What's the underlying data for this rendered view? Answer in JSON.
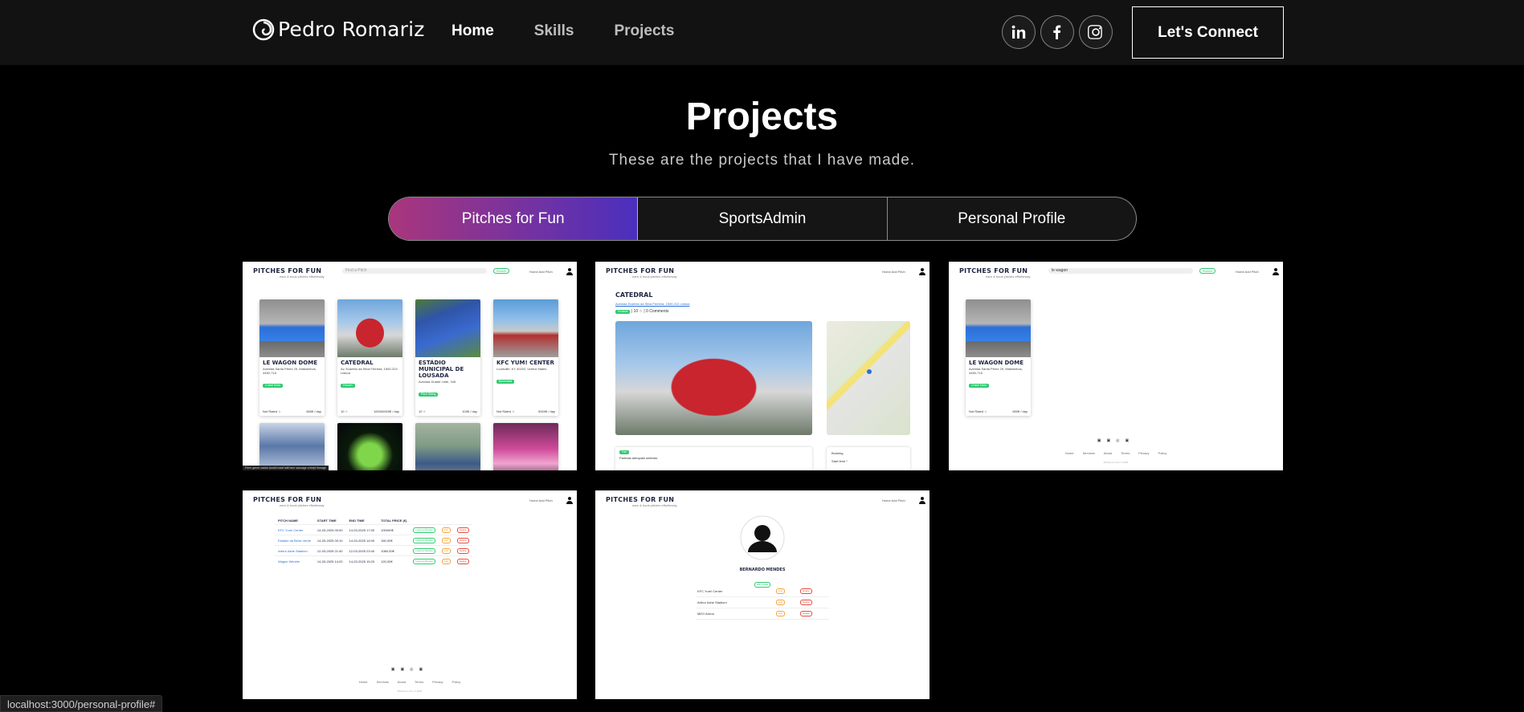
{
  "navbar": {
    "brand": "Pedro Romariz",
    "links": [
      {
        "label": "Home"
      },
      {
        "label": "Skills"
      },
      {
        "label": "Projects"
      }
    ],
    "socials": [
      "linkedin-icon",
      "facebook-icon",
      "instagram-icon"
    ],
    "connect_label": "Let's Connect"
  },
  "header": {
    "title": "Projects",
    "subtitle": "These are the projects that I have made."
  },
  "tabs": [
    {
      "label": "Pitches for Fun",
      "active": true
    },
    {
      "label": "SportsAdmin",
      "active": false
    },
    {
      "label": "Personal Profile",
      "active": false
    }
  ],
  "colors": {
    "tab_gradient_start": "#aa367c",
    "tab_gradient_end": "#4a2fbd",
    "navbar_bg": "#121212",
    "page_bg": "#000000",
    "site_green": "#2ecc71"
  },
  "mini_site": {
    "logo": "PITCHES FOR FUN",
    "tagline": "earn & book pitches effortlessly",
    "search_placeholder": "Find a Pitch",
    "search_btn": "Search",
    "nav": "Home  Add Pitch",
    "footer_links": "Home Services About Terms Privacy Policy",
    "footer_copy": "Pitches for Fun © 2025"
  },
  "project_1": {
    "pitches": [
      {
        "name": "LE WAGON DOME",
        "address": "Avenida Santa Pérez 29, Matosinhos, 4450-715",
        "badge": "Cristel Kerto",
        "rating": "Not Rated ☆",
        "price": "650€ / day"
      },
      {
        "name": "CATEDRAL",
        "address": "Av. Eusébio da Silva Ferreira, 1500-313 Lisboa",
        "badge": "Flamen",
        "rating": "10 ☆",
        "price": "100000000€ / day"
      },
      {
        "name": "ESTÁDIO MUNICIPAL DE LOUSADA",
        "address": "Avenida Duarte Leite, 345",
        "badge": "Pitch Sitting",
        "rating": "10 ☆",
        "price": "100€ / day"
      },
      {
        "name": "KFC YUM! CENTER",
        "address": "Louisville, KY 40202, United States",
        "badge": "Basketball",
        "rating": "Not Rated ☆",
        "price": "5000€ / day"
      }
    ],
    "overlay_caption": "Ferro genre cantor Aoubli meal tailt beur sausage a teept Itsnage"
  },
  "project_2": {
    "title": "CATEDRAL",
    "address": "Avenida Eusébio da Silva Ferreira, 1500-313 Lisboa",
    "badge": "Football",
    "meta": "| 10 ☆ | 0 Comments",
    "review_badge": "Fair",
    "review_text": "Partidas adequais sintéam.",
    "booking_label": "Booking",
    "start_label": "Start time *"
  },
  "project_3": {
    "search_value": "le wagon",
    "pitch": {
      "name": "LE WAGON DOME",
      "address": "Avenida Santa Pérez 29, Matosinhos, 4450-715",
      "badge": "Cristel Kerto",
      "rating": "Not Rated ☆",
      "price": "650€ / day"
    }
  },
  "project_4": {
    "columns": [
      "PITCH NAME",
      "START TIME",
      "END TIME",
      "TOTAL PRICE (€)"
    ],
    "rows": [
      [
        "KFC Yum! Center",
        "14-03-2025 00:00",
        "14-03-2025 17:00",
        "100000€"
      ],
      [
        "Estádio da Beira Verde",
        "14-03-2025 00:10",
        "14-03-2025 14:00",
        "150,00€"
      ],
      [
        "Arthur Ashe Stadium",
        "12-03-2025 21:40",
        "12-03-2025 23:40",
        "1080,00€"
      ],
      [
        "Wagon Wimble",
        "14-03-2025 14:20",
        "14-03-2025 15:20",
        "120,00€"
      ]
    ],
    "actions": {
      "review": "Leave a Review",
      "edit": "Edit",
      "delete": "Delete"
    }
  },
  "project_5": {
    "user_name": "BERNARDO MENDES",
    "edit_profile": "Edit profile",
    "pitches": [
      "KFC Yum! Center",
      "Arthur Ashe Stadium",
      "MEO Arena"
    ],
    "edit": "Edit",
    "delete": "Delete"
  },
  "status_bar": "localhost:3000/personal-profile#"
}
